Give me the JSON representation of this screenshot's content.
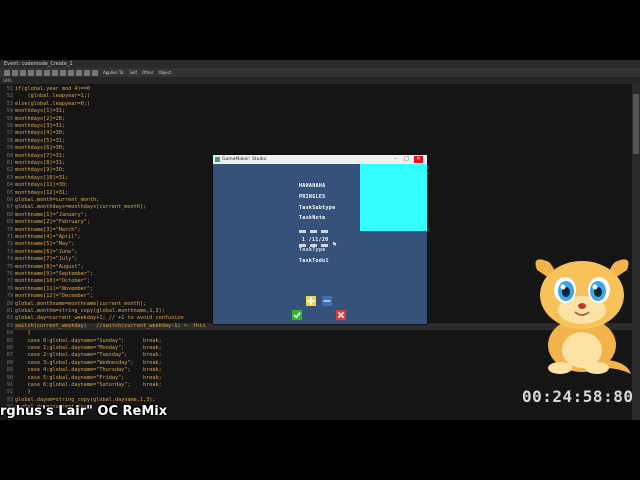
{
  "window": {
    "title": "Event: codemode_Create_1",
    "toolbar_labels": [
      "Applies To:",
      "Self",
      "Other",
      "Object"
    ]
  },
  "editor": {
    "tab_label": "GML",
    "lines": [
      {
        "n": "51",
        "t": "if(global.year mod 4)==0"
      },
      {
        "n": "52",
        "t": "    (global.leapyear=1;)"
      },
      {
        "n": "53",
        "t": "else(global.leapyear=0;)"
      },
      {
        "n": "54",
        "t": "monthdays[1]=31;"
      },
      {
        "n": "55",
        "t": "monthdays[2]=28;"
      },
      {
        "n": "56",
        "t": "monthdays[3]=31;"
      },
      {
        "n": "57",
        "t": "monthdays[4]=30;"
      },
      {
        "n": "58",
        "t": "monthdays[5]=31;"
      },
      {
        "n": "59",
        "t": "monthdays[6]=30;"
      },
      {
        "n": "60",
        "t": "monthdays[7]=31;"
      },
      {
        "n": "61",
        "t": "monthdays[8]=31;"
      },
      {
        "n": "62",
        "t": "monthdays[9]=30;"
      },
      {
        "n": "63",
        "t": "monthdays[10]=31;"
      },
      {
        "n": "64",
        "t": "monthdays[11]=30;"
      },
      {
        "n": "65",
        "t": "monthdays[12]=31;"
      },
      {
        "n": "66",
        "t": "global.month=current_month;"
      },
      {
        "n": "67",
        "t": "global.monthdays=monthdays[current_month];"
      },
      {
        "n": "68",
        "t": "monthname[1]=\"January\";"
      },
      {
        "n": "69",
        "t": "monthname[2]=\"February\";"
      },
      {
        "n": "70",
        "t": "monthname[3]=\"March\";"
      },
      {
        "n": "71",
        "t": "monthname[4]=\"April\";"
      },
      {
        "n": "72",
        "t": "monthname[5]=\"May\";"
      },
      {
        "n": "73",
        "t": "monthname[6]=\"June\";"
      },
      {
        "n": "74",
        "t": "monthname[7]=\"July\";"
      },
      {
        "n": "75",
        "t": "monthname[8]=\"August\";"
      },
      {
        "n": "76",
        "t": "monthname[9]=\"September\";"
      },
      {
        "n": "77",
        "t": "monthname[10]=\"October\";"
      },
      {
        "n": "78",
        "t": "monthname[11]=\"November\";"
      },
      {
        "n": "79",
        "t": "monthname[12]=\"December\";"
      },
      {
        "n": "80",
        "t": "global.monthname=monthname[current_month];"
      },
      {
        "n": "81",
        "t": "global.monthm=string_copy(global.monthname,1,3);"
      },
      {
        "n": "82",
        "t": "global.day=current_weekday+1; // +1 to avoid confusion"
      },
      {
        "n": "83",
        "t": "switch(current_weekday)   //switch(current_weekday-1) <- this"
      },
      {
        "n": "84",
        "t": "    {"
      },
      {
        "n": "85",
        "t": "    case 0:global.dayname=\"Sunday\";      break;"
      },
      {
        "n": "86",
        "t": "    case 1:global.dayname=\"Monday\";      break;"
      },
      {
        "n": "87",
        "t": "    case 2:global.dayname=\"Tuesday\";     break;"
      },
      {
        "n": "88",
        "t": "    case 3:global.dayname=\"Wednesday\";   break;"
      },
      {
        "n": "89",
        "t": "    case 4:global.dayname=\"Thursday\";    break;"
      },
      {
        "n": "90",
        "t": "    case 5:global.dayname=\"Friday\";      break;"
      },
      {
        "n": "91",
        "t": "    case 6:global.dayname=\"Saturday\";    break;"
      },
      {
        "n": "92",
        "t": "    }"
      },
      {
        "n": "93",
        "t": "global.daynm=string_copy(global.dayname,1,3);"
      },
      {
        "n": "94",
        "t": "global.date=current_day;"
      }
    ],
    "highlighted_line": "83"
  },
  "game_window": {
    "title": "GameMaker: Studio",
    "minimize": "–",
    "maximize": "□",
    "close": "✕",
    "items": [
      "HAHAHAHA",
      "PRINGLES",
      "TaskSubtype",
      "TaskNote",
      "1 /11/20",
      "TaskType",
      "TaskTodo1"
    ],
    "colors": {
      "background": "#36527a",
      "panel": "#33ffff",
      "plus": "#e8d84a",
      "minus": "#3f6fb3",
      "check": "#2fb52f",
      "cross": "#e03a3a"
    },
    "icons": [
      "plus-icon",
      "minus-icon",
      "checkmark-icon",
      "cross-icon"
    ]
  },
  "overlay": {
    "timer": "00:24:58:80",
    "song": "rghus's Lair\" OC ReMix"
  }
}
